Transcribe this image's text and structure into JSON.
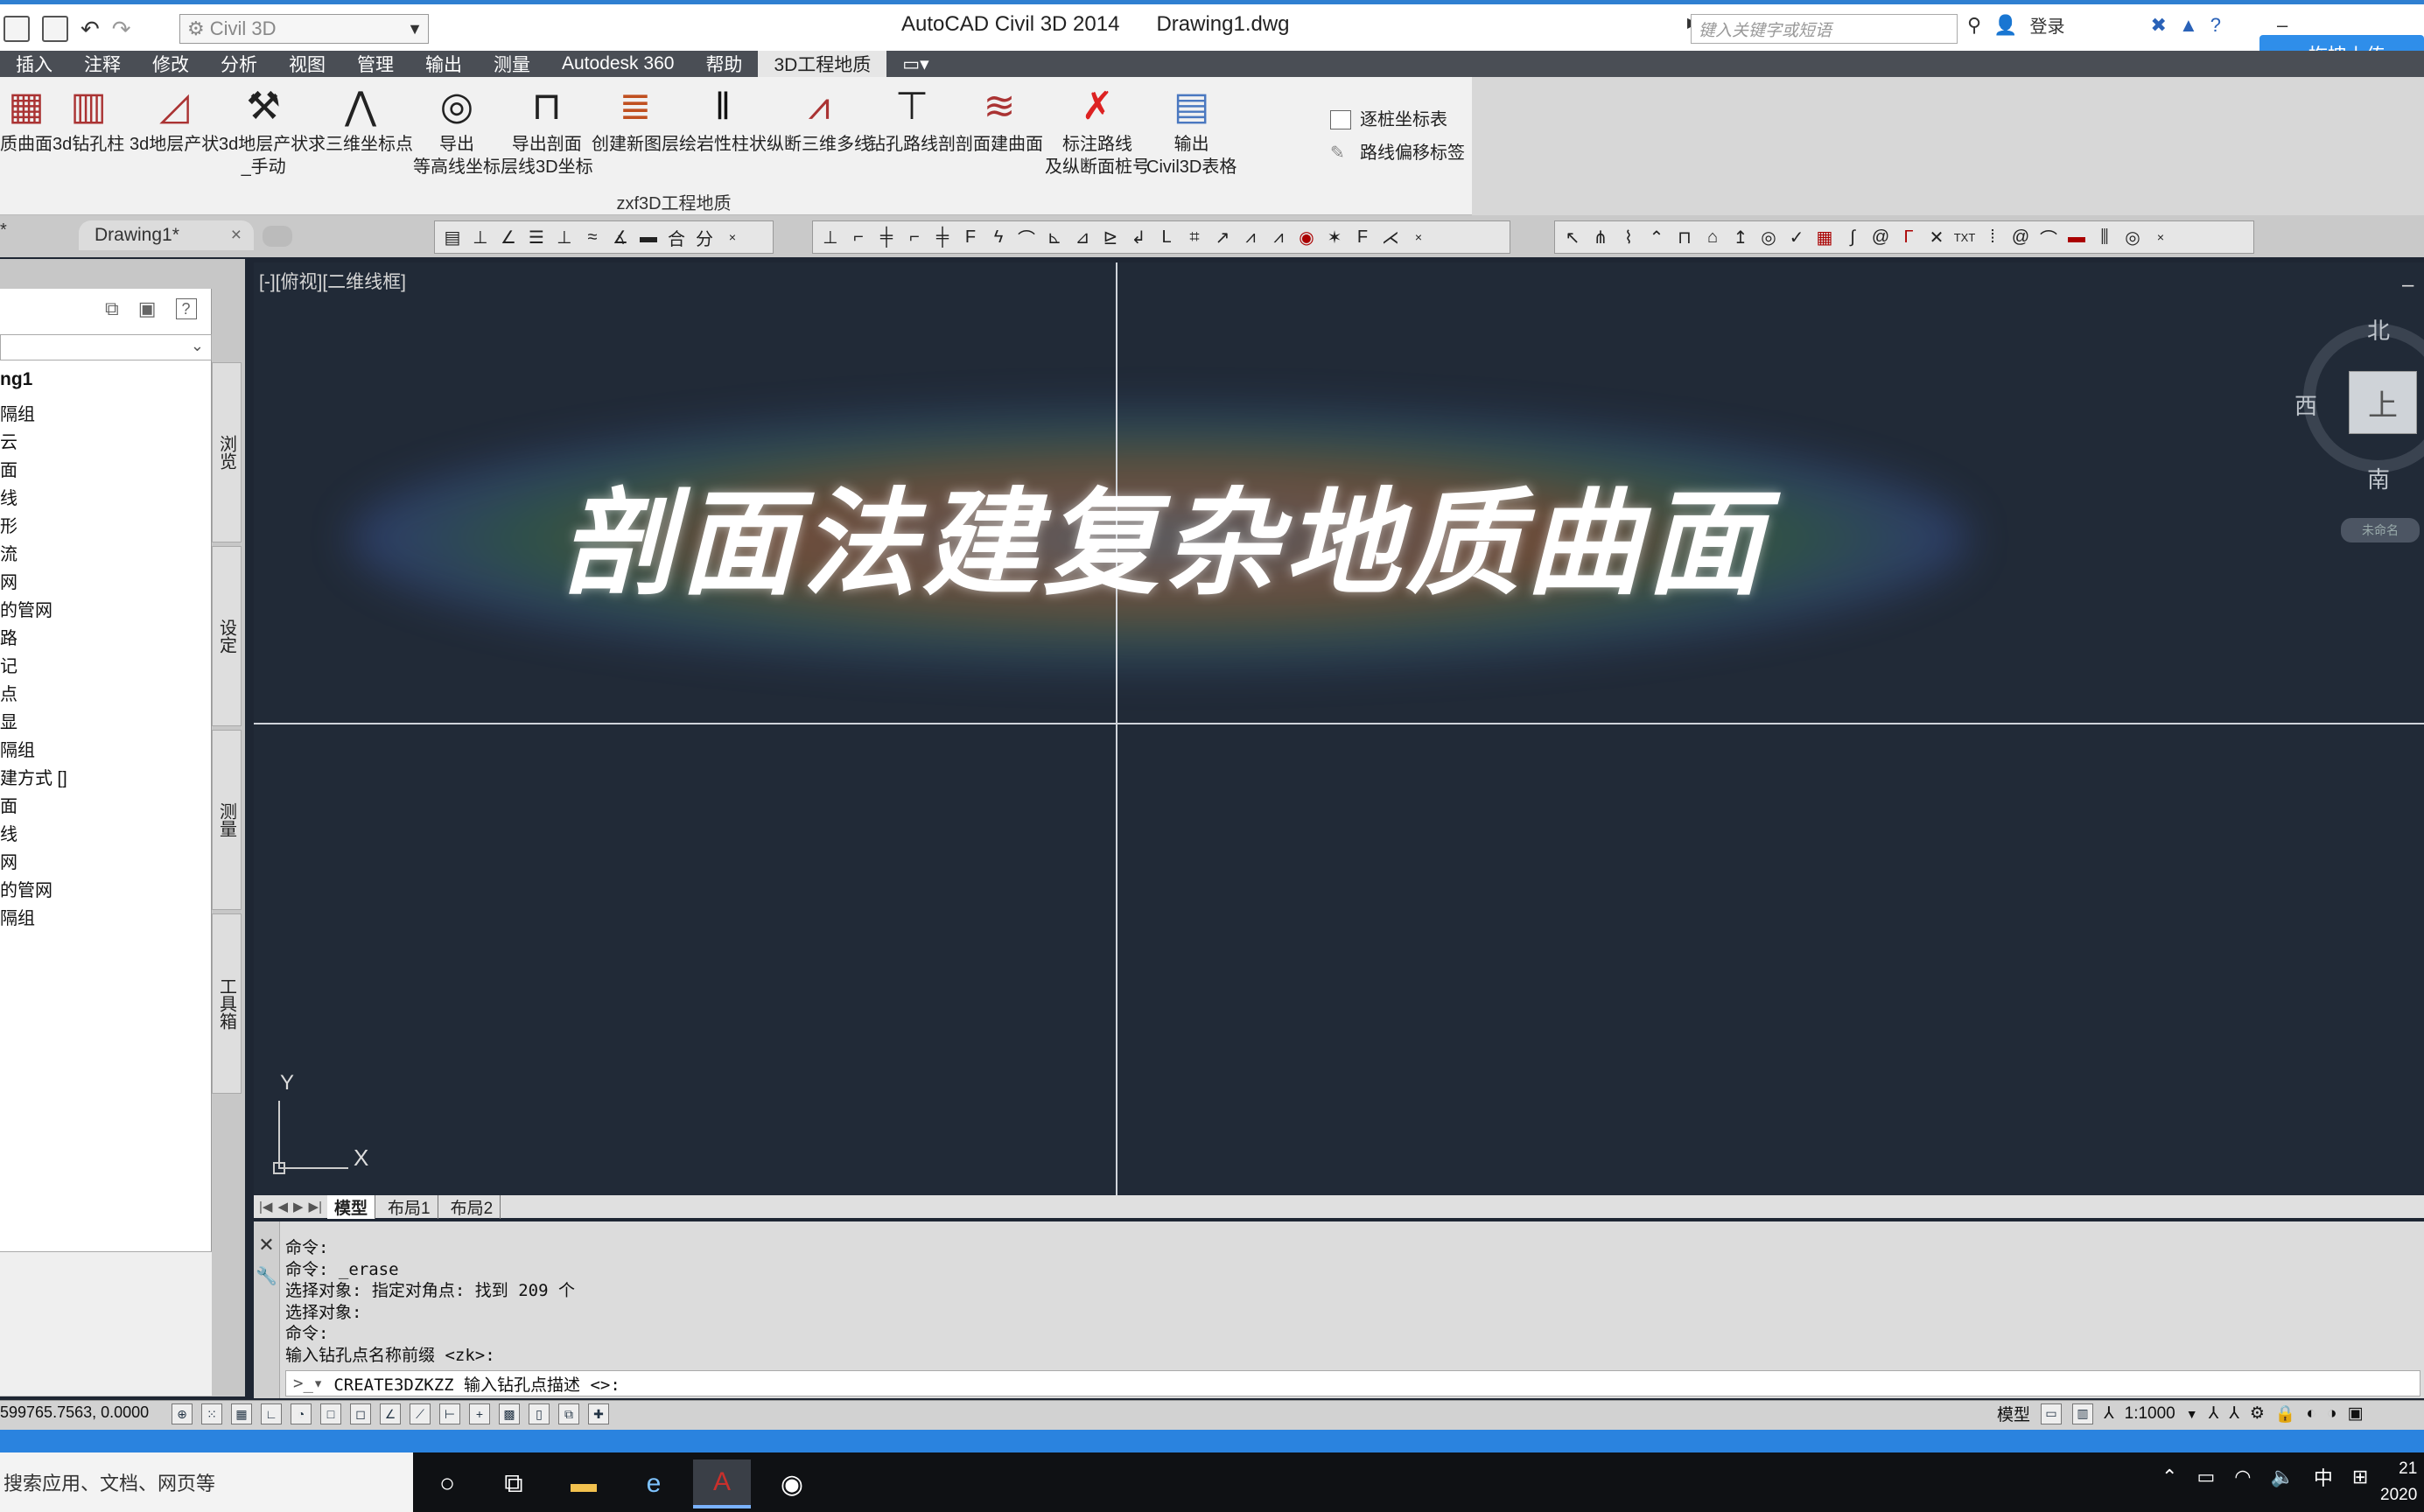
{
  "titlebar": {
    "workspace": "Civil 3D",
    "app_name": "AutoCAD Civil 3D 2014",
    "document": "Drawing1.dwg",
    "search_placeholder": "键入关键字或短语",
    "login": "登录",
    "upload_button": "拖拽上传"
  },
  "menu": [
    "插入",
    "注释",
    "修改",
    "分析",
    "视图",
    "管理",
    "输出",
    "测量",
    "Autodesk 360",
    "帮助",
    "3D工程地质"
  ],
  "menu_active_index": 10,
  "ribbon": {
    "panel_label": "zxf3D工程地质",
    "tools": [
      {
        "label": "质曲面",
        "label2": "",
        "icon": "grid-icon"
      },
      {
        "label": "3d钻孔柱",
        "label2": "",
        "icon": "borehole-icon"
      },
      {
        "label": "3d地层产状",
        "label2": "",
        "icon": "strata-icon"
      },
      {
        "label": "3d地层产状",
        "label2": "_手动",
        "icon": "strata-manual-icon"
      },
      {
        "label": "求三维坐标点",
        "label2": "",
        "icon": "coordinate-icon"
      },
      {
        "label": "导出",
        "label2": "等高线坐标",
        "icon": "contour-icon"
      },
      {
        "label": "导出剖面",
        "label2": "层线3D坐标",
        "icon": "section-export-icon"
      },
      {
        "label": "创建新图层",
        "label2": "",
        "icon": "layer-icon"
      },
      {
        "label": "绘岩性柱状",
        "label2": "",
        "icon": "lithology-icon"
      },
      {
        "label": "纵断三维多线",
        "label2": "",
        "icon": "profile-polyline-icon"
      },
      {
        "label": "钻孔路线剖",
        "label2": "",
        "icon": "drill-route-icon"
      },
      {
        "label": "剖面建曲面",
        "label2": "",
        "icon": "section-surface-icon"
      },
      {
        "label": "标注路线",
        "label2": "及纵断面桩号",
        "icon": "station-label-icon"
      },
      {
        "label": "输出",
        "label2": "Civil3D表格",
        "icon": "table-export-icon"
      }
    ],
    "small_tools": [
      "逐桩坐标表",
      "路线偏移标签"
    ]
  },
  "doc_tab": "Drawing1*",
  "palette": {
    "title": "ng1",
    "items": [
      "隔组",
      "云",
      "面",
      "线",
      "形",
      "流",
      "网",
      "的管网",
      "路",
      "记",
      "点",
      "显",
      "隔组",
      "建方式 []",
      "面",
      "线",
      "网",
      "的管网",
      "隔组"
    ],
    "side_tabs": [
      "浏览",
      "设定",
      "测量",
      "工具箱"
    ]
  },
  "viewport": {
    "label": "[-][俯视][二维线框]",
    "overlay_title": "剖面法建复杂地质曲面",
    "ucs_x": "X",
    "ucs_y": "Y"
  },
  "viewcube": {
    "north": "北",
    "south": "南",
    "west": "西",
    "top": "上",
    "unnamed": "未命名"
  },
  "layout_tabs": [
    "模型",
    "布局1",
    "布局2"
  ],
  "command_history": [
    "命令:",
    "命令: _erase",
    "选择对象: 指定对角点: 找到 209 个",
    "选择对象:",
    "命令:",
    "输入钻孔点名称前缀 <zk>:"
  ],
  "command_input": "CREATE3DZKZZ 输入钻孔点描述 <>:",
  "status": {
    "coords": "599765.7563, 0.0000",
    "model": "模型",
    "scale": "1:1000"
  },
  "taskbar": {
    "search": "搜索应用、文档、网页等",
    "ime": "中",
    "time": "21",
    "date": "2020"
  },
  "colors": {
    "accent": "#2f7fd1",
    "canvas": "#212a37",
    "menubar": "#4a4e55",
    "upload": "#2f8eea"
  }
}
